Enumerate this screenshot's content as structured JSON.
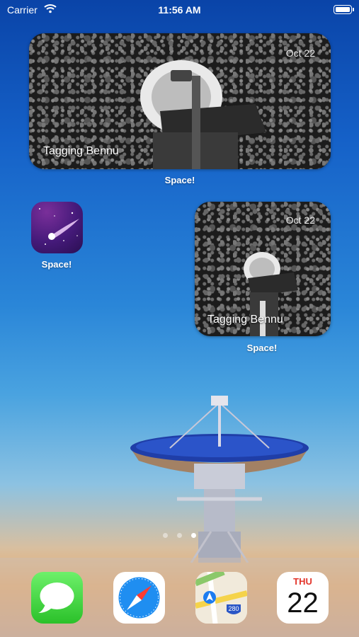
{
  "status_bar": {
    "carrier": "Carrier",
    "time": "11:56 AM"
  },
  "widgets": [
    {
      "date": "Oct 22",
      "title": "Tagging Bennu",
      "caption": "Space!"
    },
    {
      "date": "Oct 22",
      "title": "Tagging Bennu",
      "caption": "Space!"
    }
  ],
  "apps": [
    {
      "name": "Space!",
      "icon": "shooting-star-icon"
    }
  ],
  "page_dots": {
    "count": 3,
    "active": 2
  },
  "dock": [
    {
      "icon": "messages-icon"
    },
    {
      "icon": "safari-compass-icon"
    },
    {
      "icon": "maps-icon",
      "badge": "280"
    },
    {
      "icon": "calendar-icon",
      "day": "THU",
      "date": "22"
    }
  ]
}
